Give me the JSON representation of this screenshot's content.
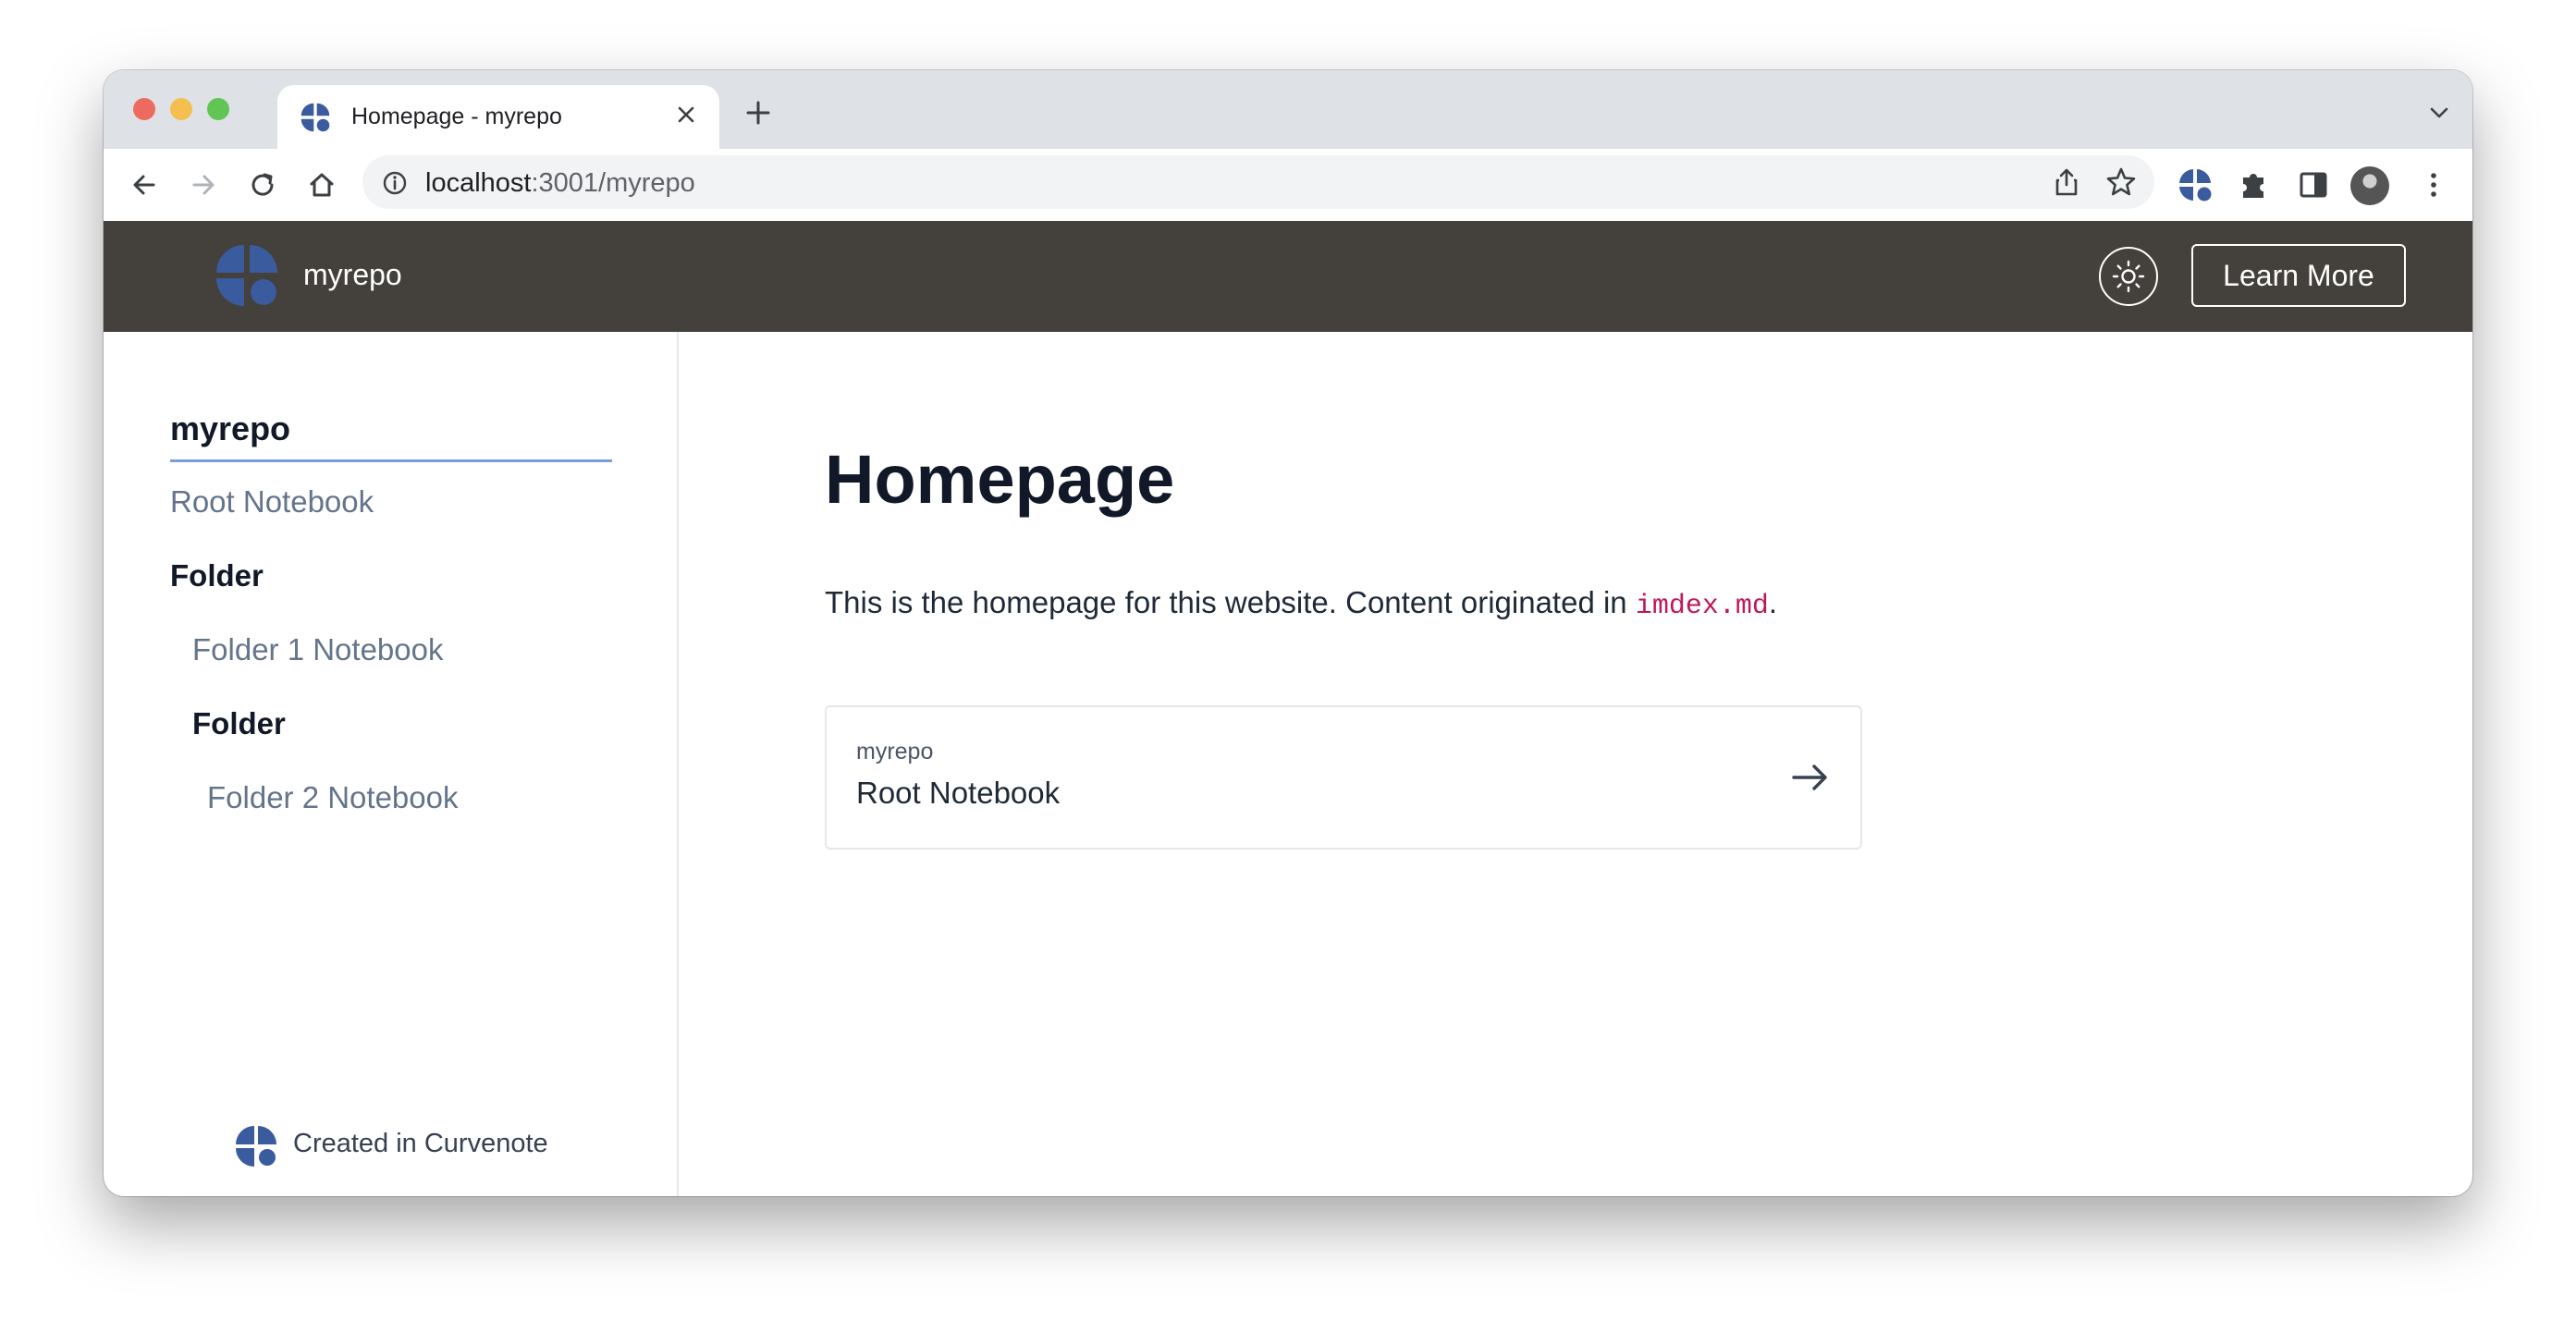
{
  "browser": {
    "tab_title": "Homepage - myrepo",
    "url_host": "localhost",
    "url_path": ":3001/myrepo"
  },
  "site": {
    "title": "myrepo",
    "learn_more_label": "Learn More",
    "brand_color": "#3b5b9f",
    "header_bg": "#44403c"
  },
  "sidebar": {
    "project": "myrepo",
    "items": [
      {
        "label": "Root Notebook"
      },
      {
        "label": "Folder"
      },
      {
        "label": "Folder 1 Notebook"
      },
      {
        "label": "Folder"
      },
      {
        "label": "Folder 2 Notebook"
      }
    ],
    "footer": "Created in Curvenote"
  },
  "main": {
    "title": "Homepage",
    "body_prefix": "This is the homepage for this website. Content originated in ",
    "body_code": "imdex.md",
    "body_suffix": ".",
    "card": {
      "kicker": "myrepo",
      "title": "Root Notebook"
    }
  }
}
